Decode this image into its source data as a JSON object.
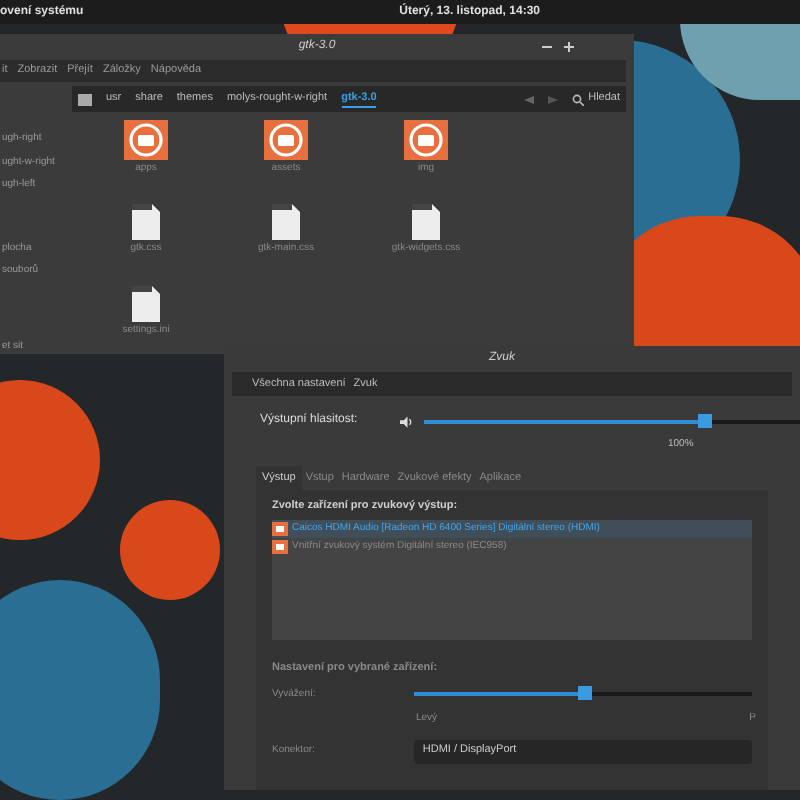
{
  "top_panel": {
    "left_text": "ovení systému",
    "clock": "Úterý, 13. listopad, 14:30"
  },
  "file_manager": {
    "title": "gtk-3.0",
    "menu": [
      "it",
      "Zobrazit",
      "Přejít",
      "Záložky",
      "Nápověda"
    ],
    "path": [
      {
        "label": "usr",
        "selected": false
      },
      {
        "label": "share",
        "selected": false
      },
      {
        "label": "themes",
        "selected": false
      },
      {
        "label": "molys-rought-w-right",
        "selected": false
      },
      {
        "label": "gtk-3.0",
        "selected": true
      }
    ],
    "search": {
      "label": "Hledat"
    },
    "sidebar": [
      "ugh-right",
      "ught-w-right",
      "ugh-left",
      "plocha",
      "souborů",
      "et sit"
    ],
    "files": [
      {
        "name": "apps",
        "kind": "folder"
      },
      {
        "name": "assets",
        "kind": "folder"
      },
      {
        "name": "img",
        "kind": "folder"
      },
      {
        "name": "gtk.css",
        "kind": "file"
      },
      {
        "name": "gtk-main.css",
        "kind": "file"
      },
      {
        "name": "gtk-widgets.css",
        "kind": "file"
      },
      {
        "name": "settings.ini",
        "kind": "file"
      }
    ]
  },
  "sound": {
    "title": "Zvuk",
    "breadcrumb": [
      "Všechna nastavení",
      "Zvuk"
    ],
    "output_volume": {
      "label": "Výstupní hlasitost:",
      "level": 0.7,
      "reading": "100%"
    },
    "tabs": [
      {
        "label": "Výstup",
        "selected": true
      },
      {
        "label": "Vstup",
        "selected": false
      },
      {
        "label": "Hardware",
        "selected": false
      },
      {
        "label": "Zvukové efekty",
        "selected": false
      },
      {
        "label": "Aplikace",
        "selected": false
      }
    ],
    "device_heading": "Zvolte zařízení pro zvukový výstup:",
    "devices": [
      {
        "name": "Caicos HDMI Audio [Radeon HD 6400 Series] Digitální stereo (HDMI)",
        "selected": true
      },
      {
        "name": "Vnitřní zvukový systém Digitální stereo (IEC958)",
        "selected": false
      }
    ],
    "settings_heading": "Nastavení pro vybrané zařízení:",
    "balance": {
      "label": "Vyvážení:",
      "level": 0.5,
      "left_label": "Levý",
      "right_label": "P"
    },
    "connector": {
      "label": "Konektor:",
      "value": "HDMI / DisplayPort"
    }
  }
}
